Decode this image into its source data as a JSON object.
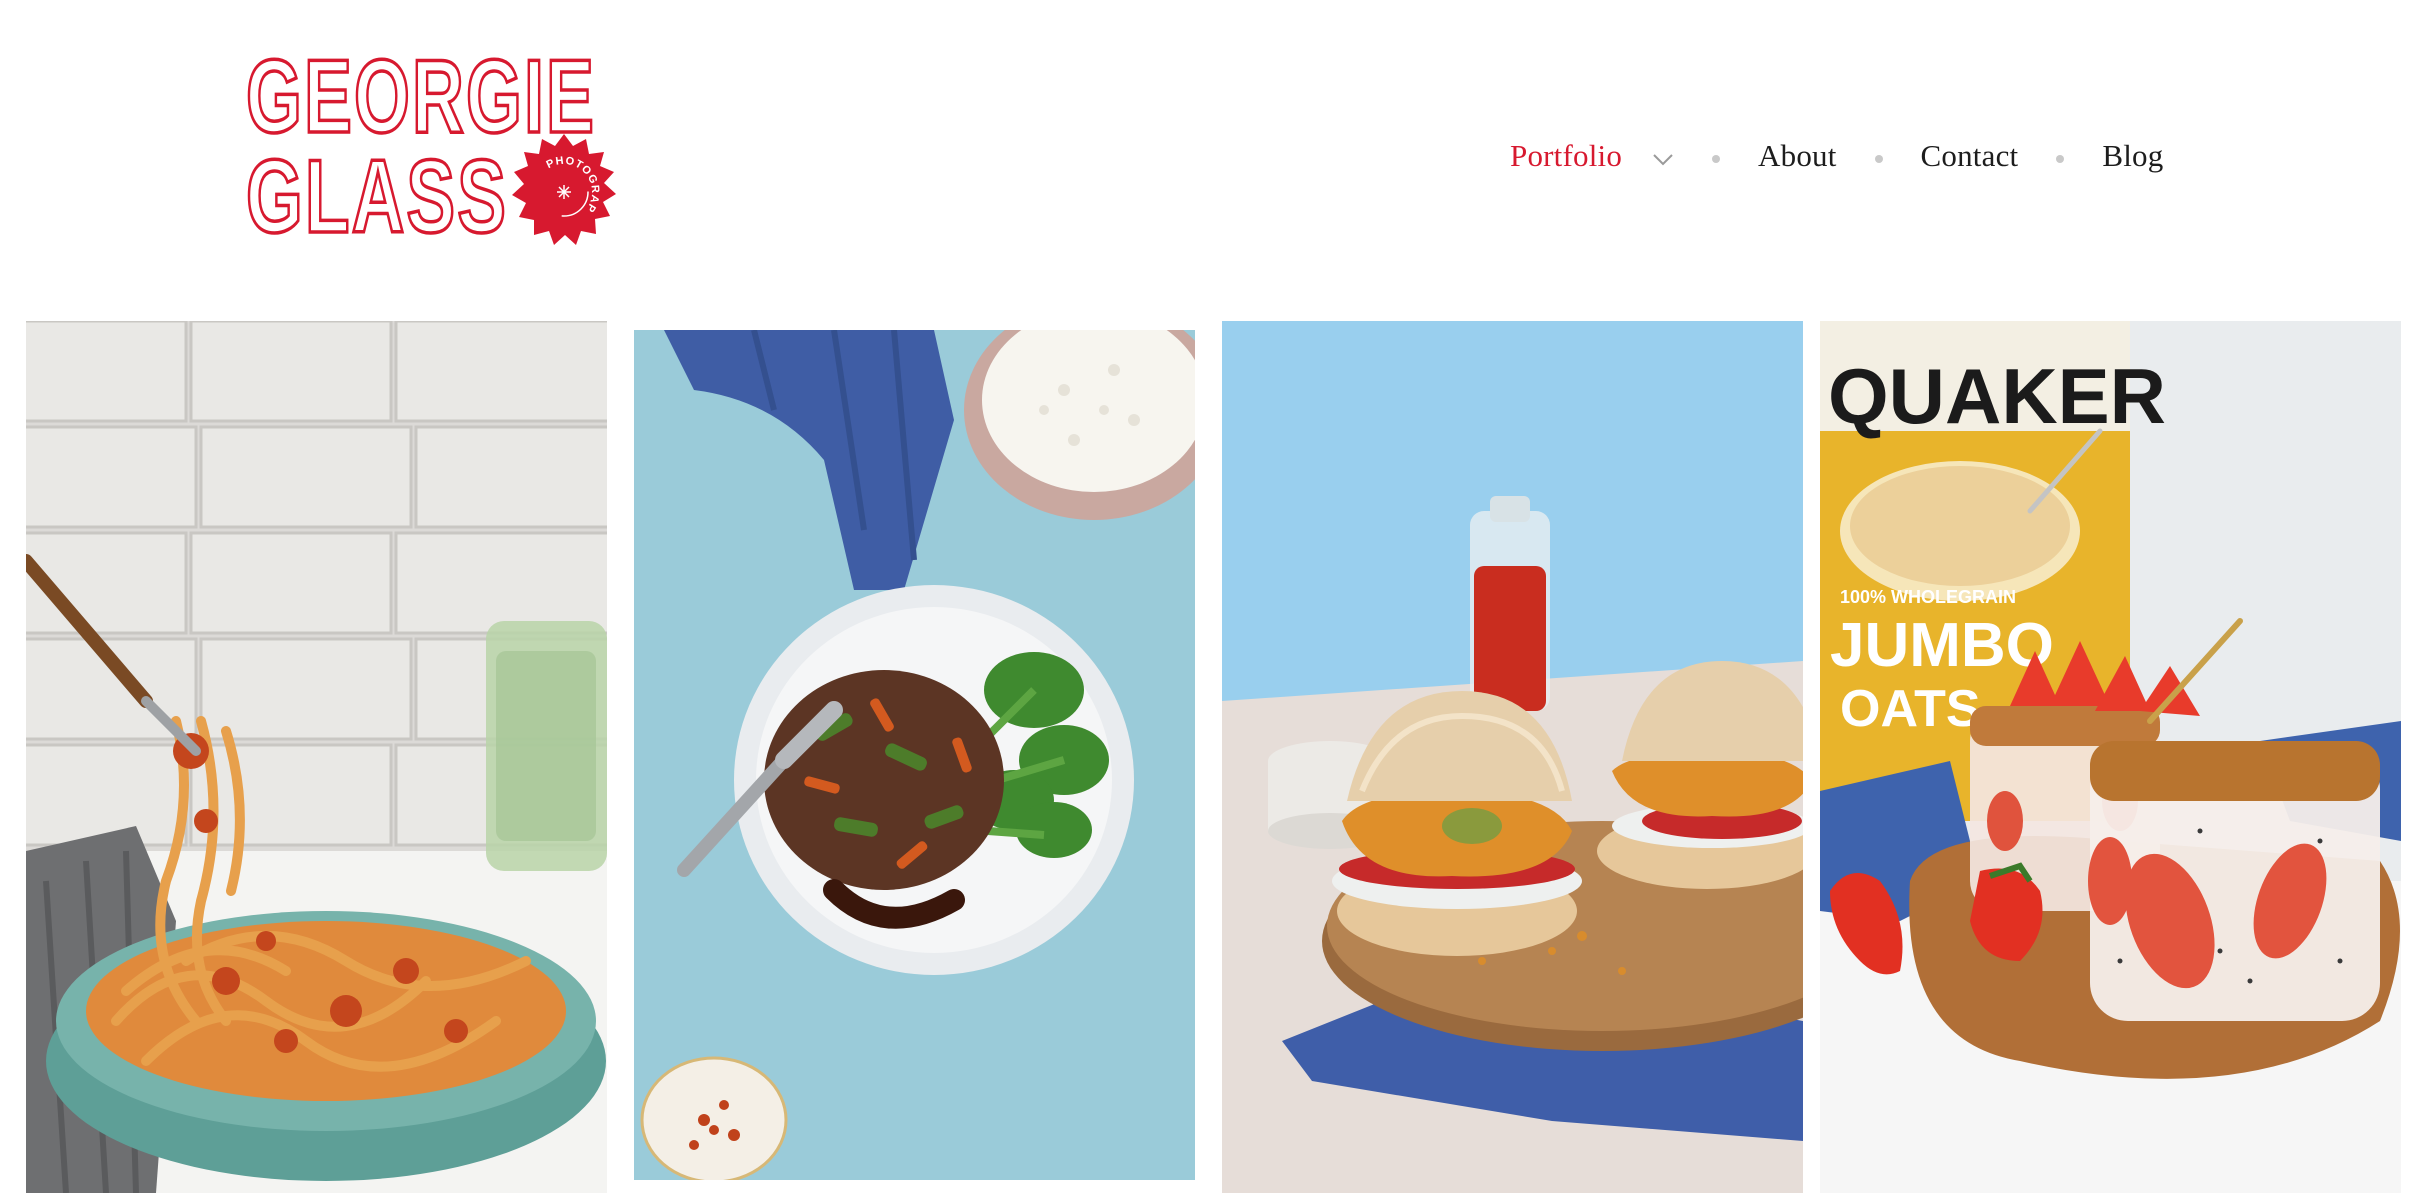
{
  "logo": {
    "line1": "GEORGIE",
    "line2": "GLASS",
    "badge_text": "PHOTOGRAPHY",
    "color": "#d7192f"
  },
  "nav": {
    "items": [
      {
        "label": "Portfolio",
        "active": true,
        "has_dropdown": true
      },
      {
        "label": "About",
        "active": false
      },
      {
        "label": "Contact",
        "active": false
      },
      {
        "label": "Blog",
        "active": false
      }
    ],
    "active_color": "#d7192f",
    "text_color": "#1d1d1d",
    "separator_color": "#c9c9c9"
  },
  "gallery": {
    "tiles": [
      {
        "subject": "pasta-tagliatelle-bowl",
        "background": "white-brick-wall"
      },
      {
        "subject": "pepper-steak-stir-fry-with-rice",
        "background": "blue-textured"
      },
      {
        "subject": "fish-burgers-on-board",
        "background": "light-blue"
      },
      {
        "subject": "strawberry-overnight-oats-jars",
        "background": "white"
      }
    ],
    "product_label": {
      "brand": "QUAKER",
      "claim": "100% WHOLEGRAIN",
      "product": "JUMBO",
      "product_sub": "OATS"
    }
  }
}
